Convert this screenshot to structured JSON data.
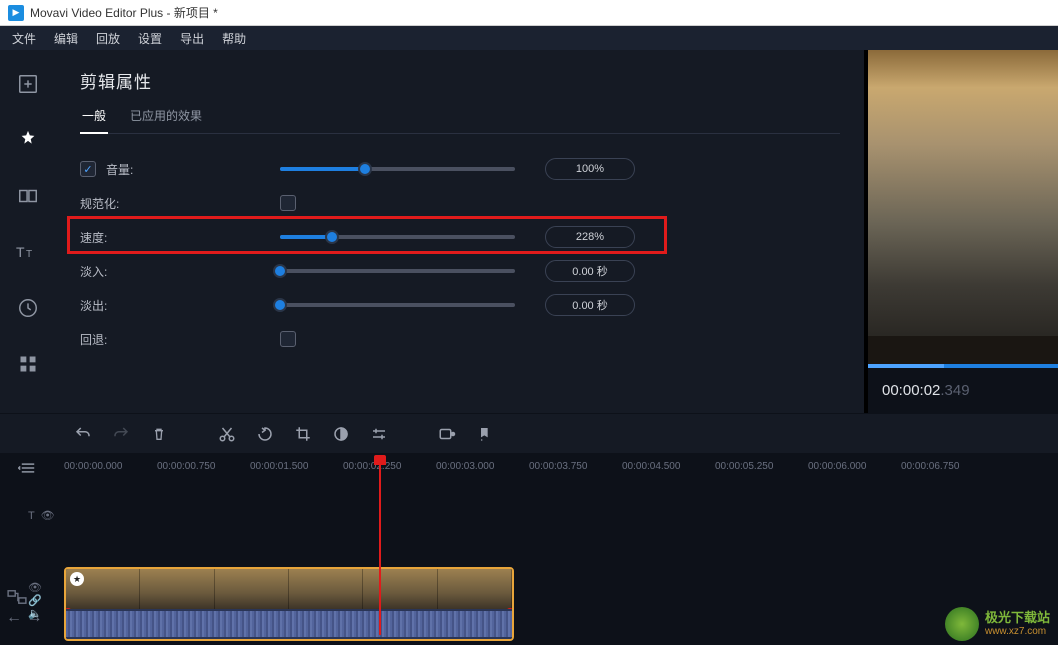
{
  "window": {
    "title": "Movavi Video Editor Plus - 新项目 *"
  },
  "menubar": [
    "文件",
    "编辑",
    "回放",
    "设置",
    "导出",
    "帮助"
  ],
  "panel": {
    "title": "剪辑属性",
    "tabs": {
      "general": "一般",
      "effects": "已应用的效果"
    },
    "rows": {
      "volume": {
        "label": "音量:",
        "value": "100%",
        "fill": 36
      },
      "normalize": {
        "label": "规范化:"
      },
      "speed": {
        "label": "速度:",
        "value": "228%",
        "fill": 22
      },
      "fadein": {
        "label": "淡入:",
        "value": "0.00 秒",
        "fill": 0
      },
      "fadeout": {
        "label": "淡出:",
        "value": "0.00 秒",
        "fill": 0
      },
      "reverse": {
        "label": "回退:"
      }
    }
  },
  "preview": {
    "time_main": "00:00:02",
    "time_ms": ".349"
  },
  "ruler": [
    "00:00:00.000",
    "00:00:00.750",
    "00:00:01.500",
    "00:00:02.250",
    "00:00:03.000",
    "00:00:03.750",
    "00:00:04.500",
    "00:00:05.250",
    "00:00:06.000",
    "00:00:06.750"
  ],
  "watermark": {
    "name": "极光下载站",
    "url": "www.xz7.com"
  }
}
